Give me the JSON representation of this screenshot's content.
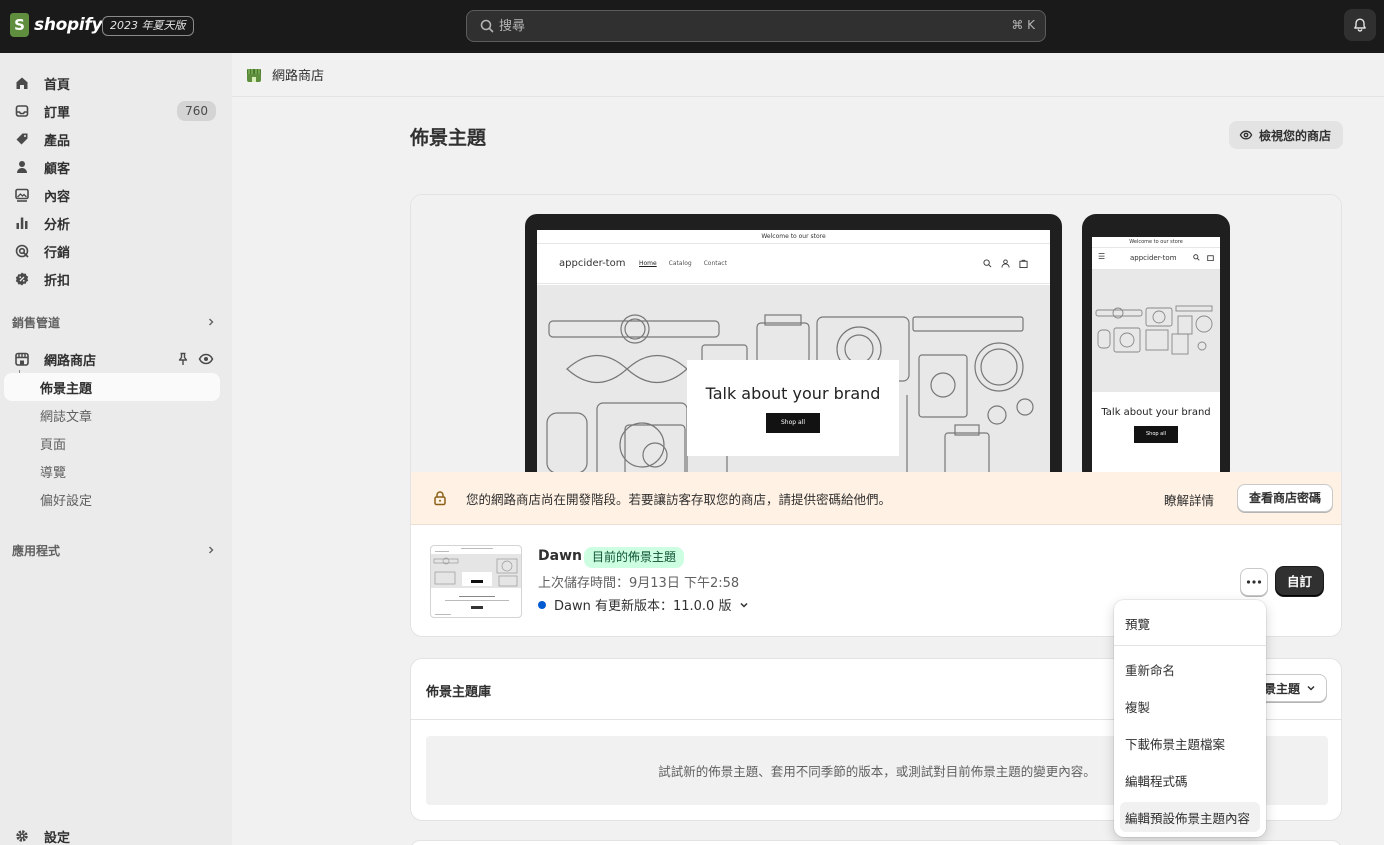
{
  "topbar": {
    "logo_text": "shopify",
    "edition": "2023 年夏天版",
    "search_placeholder": "搜尋",
    "search_shortcut": "⌘ K"
  },
  "sidebar": {
    "items": [
      {
        "label": "首頁",
        "icon": "home-icon"
      },
      {
        "label": "訂單",
        "icon": "orders-icon",
        "badge": "760"
      },
      {
        "label": "產品",
        "icon": "tag-icon"
      },
      {
        "label": "顧客",
        "icon": "person-icon"
      },
      {
        "label": "內容",
        "icon": "content-icon"
      },
      {
        "label": "分析",
        "icon": "bar-chart-icon"
      },
      {
        "label": "行銷",
        "icon": "target-icon"
      },
      {
        "label": "折扣",
        "icon": "discount-icon"
      }
    ],
    "sales_channels_label": "銷售管道",
    "online_store": {
      "label": "網路商店",
      "subitems": [
        "佈景主題",
        "網誌文章",
        "頁面",
        "導覽",
        "偏好設定"
      ]
    },
    "apps_label": "應用程式",
    "settings_label": "設定"
  },
  "breadcrumb": "網路商店",
  "page": {
    "title": "佈景主題",
    "view_store_label": "檢視您的商店"
  },
  "preview": {
    "announcement": "Welcome to our store",
    "brand": "appcider-tom",
    "nav": [
      "Home",
      "Catalog",
      "Contact"
    ],
    "hero_title": "Talk about your brand",
    "hero_button": "Shop all"
  },
  "notice": {
    "text": "您的網路商店尚在開發階段。若要讓訪客存取您的商店，請提供密碼給他們。",
    "learn_more": "瞭解詳情",
    "password_button": "查看商店密碼"
  },
  "current_theme": {
    "name": "Dawn",
    "badge": "目前的佈景主題",
    "saved": "上次儲存時間：9月13日 下午2:58",
    "update": "Dawn 有更新版本：11.0.0 版",
    "customize_label": "自訂"
  },
  "menu": {
    "items": [
      "預覽",
      "重新命名",
      "複製",
      "下載佈景主題檔案",
      "編輯程式碼",
      "編輯預設佈景主題內容"
    ]
  },
  "library": {
    "title": "佈景主題庫",
    "add_button": "景主題",
    "empty_text": "試試新的佈景主題、套用不同季節的版本，或測試對目前佈景主題的變更內容。"
  },
  "colors": {
    "topbar": "#1a1a1a",
    "brand_green": "#5e8e3e",
    "badge_success_bg": "#cdfee1",
    "notice_bg": "#fff1e3",
    "update_dot": "#005bd3"
  }
}
